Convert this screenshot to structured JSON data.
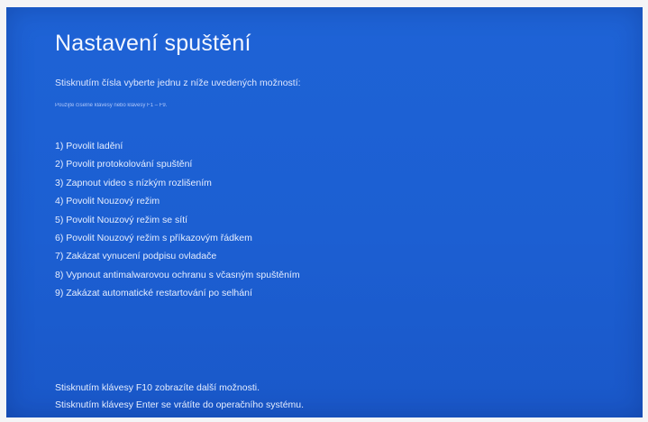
{
  "screen": {
    "title": "Nastavení spuštění",
    "instruction": "Stisknutím čísla vyberte jednu z níže uvedených možností:",
    "hint": "Použijte číselné klávesy nebo klávesy F1 – F9.",
    "options": [
      "1) Povolit ladění",
      "2) Povolit protokolování spuštění",
      "3) Zapnout video s nízkým rozlišením",
      "4) Povolit Nouzový režim",
      "5) Povolit Nouzový režim se sítí",
      "6) Povolit Nouzový režim s příkazovým řádkem",
      "7) Zakázat vynucení podpisu ovladače",
      "8) Vypnout antimalwarovou ochranu s včasným spuštěním",
      "9) Zakázat automatické restartování po selhání"
    ],
    "footer": {
      "more_options": "Stisknutím klávesy F10 zobrazíte další možnosti.",
      "return": "Stisknutím klávesy Enter se vrátíte do operačního systému."
    }
  },
  "colors": {
    "background": "#1c5fd2",
    "text": "#e6eeff"
  }
}
